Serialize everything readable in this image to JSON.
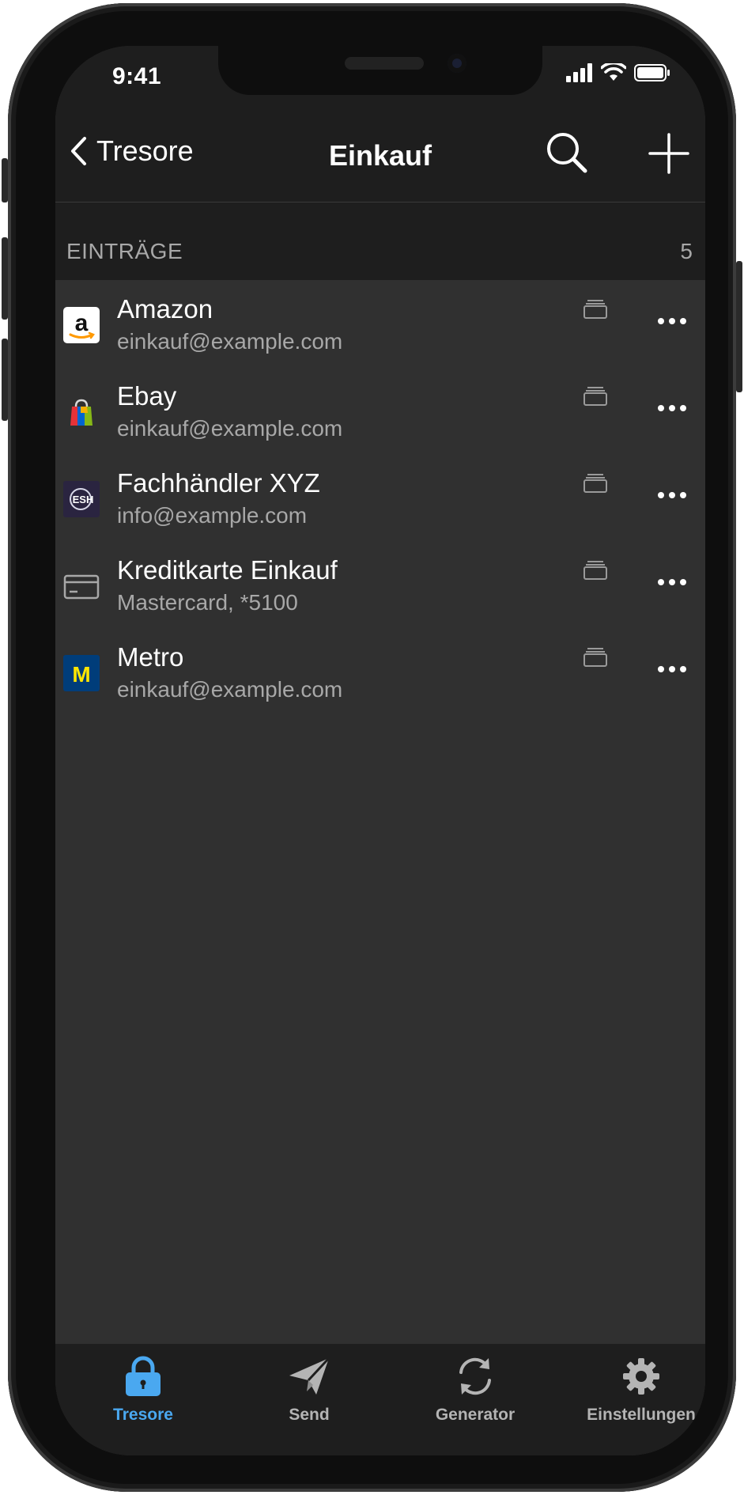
{
  "status_bar": {
    "time": "9:41"
  },
  "nav": {
    "back_label": "Tresore",
    "title": "Einkauf"
  },
  "section": {
    "title": "EINTRÄGE",
    "count": "5"
  },
  "items": [
    {
      "title": "Amazon",
      "subtitle": "einkauf@example.com",
      "icon": "amazon-logo-icon"
    },
    {
      "title": "Ebay",
      "subtitle": "einkauf@example.com",
      "icon": "ebay-bag-icon"
    },
    {
      "title": "Fachhändler XYZ",
      "subtitle": "info@example.com",
      "icon": "esh-logo-icon",
      "icon_text": "ESH"
    },
    {
      "title": "Kreditkarte Einkauf",
      "subtitle": "Mastercard, *5100",
      "icon": "credit-card-icon"
    },
    {
      "title": "Metro",
      "subtitle": "einkauf@example.com",
      "icon": "metro-logo-icon",
      "icon_text": "M"
    }
  ],
  "tabs": [
    {
      "label": "Tresore",
      "icon": "lock-icon",
      "active": true
    },
    {
      "label": "Send",
      "icon": "send-icon",
      "active": false
    },
    {
      "label": "Generator",
      "icon": "refresh-icon",
      "active": false
    },
    {
      "label": "Einstellungen",
      "icon": "gear-icon",
      "active": false
    }
  ],
  "colors": {
    "background": "#303030",
    "header": "#1e1e1e",
    "accent": "#4aa8f0",
    "text_primary": "#ffffff",
    "text_secondary": "#a8a8a8"
  }
}
